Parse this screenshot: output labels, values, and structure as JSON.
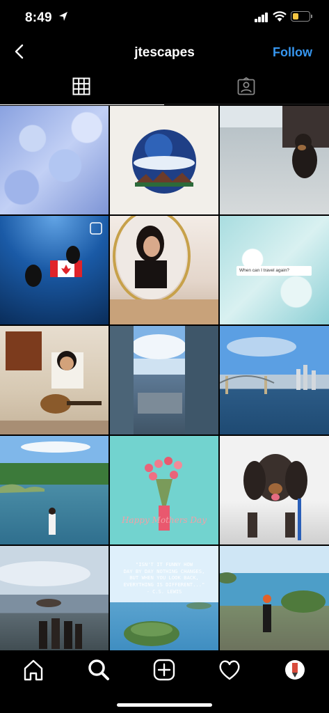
{
  "status_bar": {
    "time": "8:49"
  },
  "header": {
    "title": "jtescapes",
    "follow_label": "Follow"
  },
  "tabs": [
    {
      "name": "grid",
      "active": true
    },
    {
      "name": "tagged",
      "active": false
    }
  ],
  "posts": {
    "p6_search_text": "When can I travel again?",
    "p11_caption": "Happy Mothers Day",
    "p14_quote": "\"ISN'T IT FUNNY HOW\nDAY BY DAY NOTHING CHANGES,\nBUT WHEN YOU LOOK BACK,\nEVERYTHING IS DIFFERENT...\"",
    "p14_author": "- C.S. LEWIS"
  },
  "bottom_nav": [
    "home",
    "search",
    "new-post",
    "activity",
    "profile"
  ],
  "colors": {
    "accent": "#3797f0",
    "background": "#000000"
  }
}
